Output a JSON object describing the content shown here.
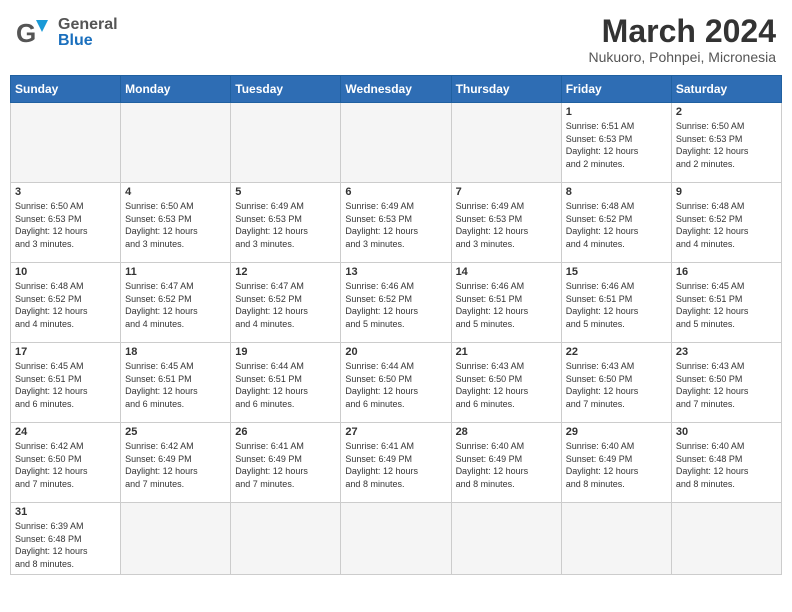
{
  "header": {
    "logo_general": "General",
    "logo_blue": "Blue",
    "month_title": "March 2024",
    "location": "Nukuoro, Pohnpei, Micronesia"
  },
  "weekdays": [
    "Sunday",
    "Monday",
    "Tuesday",
    "Wednesday",
    "Thursday",
    "Friday",
    "Saturday"
  ],
  "weeks": [
    [
      {
        "day": "",
        "info": ""
      },
      {
        "day": "",
        "info": ""
      },
      {
        "day": "",
        "info": ""
      },
      {
        "day": "",
        "info": ""
      },
      {
        "day": "",
        "info": ""
      },
      {
        "day": "1",
        "info": "Sunrise: 6:51 AM\nSunset: 6:53 PM\nDaylight: 12 hours\nand 2 minutes."
      },
      {
        "day": "2",
        "info": "Sunrise: 6:50 AM\nSunset: 6:53 PM\nDaylight: 12 hours\nand 2 minutes."
      }
    ],
    [
      {
        "day": "3",
        "info": "Sunrise: 6:50 AM\nSunset: 6:53 PM\nDaylight: 12 hours\nand 3 minutes."
      },
      {
        "day": "4",
        "info": "Sunrise: 6:50 AM\nSunset: 6:53 PM\nDaylight: 12 hours\nand 3 minutes."
      },
      {
        "day": "5",
        "info": "Sunrise: 6:49 AM\nSunset: 6:53 PM\nDaylight: 12 hours\nand 3 minutes."
      },
      {
        "day": "6",
        "info": "Sunrise: 6:49 AM\nSunset: 6:53 PM\nDaylight: 12 hours\nand 3 minutes."
      },
      {
        "day": "7",
        "info": "Sunrise: 6:49 AM\nSunset: 6:53 PM\nDaylight: 12 hours\nand 3 minutes."
      },
      {
        "day": "8",
        "info": "Sunrise: 6:48 AM\nSunset: 6:52 PM\nDaylight: 12 hours\nand 4 minutes."
      },
      {
        "day": "9",
        "info": "Sunrise: 6:48 AM\nSunset: 6:52 PM\nDaylight: 12 hours\nand 4 minutes."
      }
    ],
    [
      {
        "day": "10",
        "info": "Sunrise: 6:48 AM\nSunset: 6:52 PM\nDaylight: 12 hours\nand 4 minutes."
      },
      {
        "day": "11",
        "info": "Sunrise: 6:47 AM\nSunset: 6:52 PM\nDaylight: 12 hours\nand 4 minutes."
      },
      {
        "day": "12",
        "info": "Sunrise: 6:47 AM\nSunset: 6:52 PM\nDaylight: 12 hours\nand 4 minutes."
      },
      {
        "day": "13",
        "info": "Sunrise: 6:46 AM\nSunset: 6:52 PM\nDaylight: 12 hours\nand 5 minutes."
      },
      {
        "day": "14",
        "info": "Sunrise: 6:46 AM\nSunset: 6:51 PM\nDaylight: 12 hours\nand 5 minutes."
      },
      {
        "day": "15",
        "info": "Sunrise: 6:46 AM\nSunset: 6:51 PM\nDaylight: 12 hours\nand 5 minutes."
      },
      {
        "day": "16",
        "info": "Sunrise: 6:45 AM\nSunset: 6:51 PM\nDaylight: 12 hours\nand 5 minutes."
      }
    ],
    [
      {
        "day": "17",
        "info": "Sunrise: 6:45 AM\nSunset: 6:51 PM\nDaylight: 12 hours\nand 6 minutes."
      },
      {
        "day": "18",
        "info": "Sunrise: 6:45 AM\nSunset: 6:51 PM\nDaylight: 12 hours\nand 6 minutes."
      },
      {
        "day": "19",
        "info": "Sunrise: 6:44 AM\nSunset: 6:51 PM\nDaylight: 12 hours\nand 6 minutes."
      },
      {
        "day": "20",
        "info": "Sunrise: 6:44 AM\nSunset: 6:50 PM\nDaylight: 12 hours\nand 6 minutes."
      },
      {
        "day": "21",
        "info": "Sunrise: 6:43 AM\nSunset: 6:50 PM\nDaylight: 12 hours\nand 6 minutes."
      },
      {
        "day": "22",
        "info": "Sunrise: 6:43 AM\nSunset: 6:50 PM\nDaylight: 12 hours\nand 7 minutes."
      },
      {
        "day": "23",
        "info": "Sunrise: 6:43 AM\nSunset: 6:50 PM\nDaylight: 12 hours\nand 7 minutes."
      }
    ],
    [
      {
        "day": "24",
        "info": "Sunrise: 6:42 AM\nSunset: 6:50 PM\nDaylight: 12 hours\nand 7 minutes."
      },
      {
        "day": "25",
        "info": "Sunrise: 6:42 AM\nSunset: 6:49 PM\nDaylight: 12 hours\nand 7 minutes."
      },
      {
        "day": "26",
        "info": "Sunrise: 6:41 AM\nSunset: 6:49 PM\nDaylight: 12 hours\nand 7 minutes."
      },
      {
        "day": "27",
        "info": "Sunrise: 6:41 AM\nSunset: 6:49 PM\nDaylight: 12 hours\nand 8 minutes."
      },
      {
        "day": "28",
        "info": "Sunrise: 6:40 AM\nSunset: 6:49 PM\nDaylight: 12 hours\nand 8 minutes."
      },
      {
        "day": "29",
        "info": "Sunrise: 6:40 AM\nSunset: 6:49 PM\nDaylight: 12 hours\nand 8 minutes."
      },
      {
        "day": "30",
        "info": "Sunrise: 6:40 AM\nSunset: 6:48 PM\nDaylight: 12 hours\nand 8 minutes."
      }
    ],
    [
      {
        "day": "31",
        "info": "Sunrise: 6:39 AM\nSunset: 6:48 PM\nDaylight: 12 hours\nand 8 minutes."
      },
      {
        "day": "",
        "info": ""
      },
      {
        "day": "",
        "info": ""
      },
      {
        "day": "",
        "info": ""
      },
      {
        "day": "",
        "info": ""
      },
      {
        "day": "",
        "info": ""
      },
      {
        "day": "",
        "info": ""
      }
    ]
  ]
}
